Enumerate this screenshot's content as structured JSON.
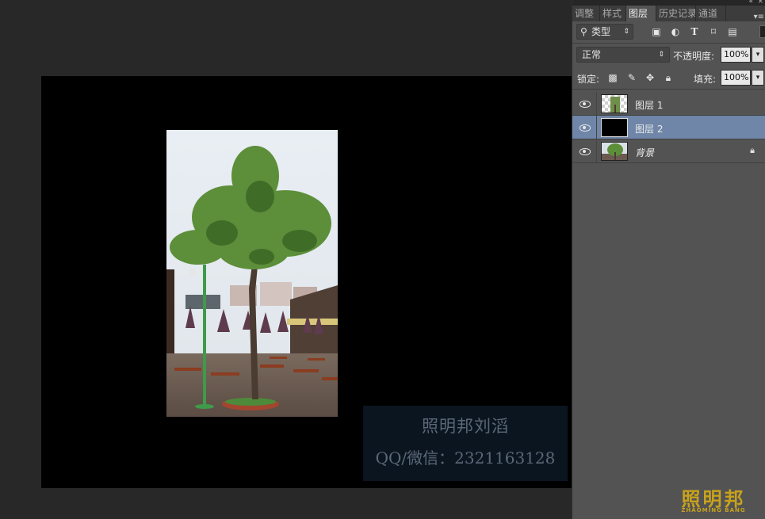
{
  "panel": {
    "tabs": [
      "调整",
      "样式",
      "图层",
      "历史记录",
      "通道"
    ],
    "filter": {
      "selected": "类型"
    },
    "blend_mode": "正常",
    "opacity_label": "不透明度:",
    "opacity_value": "100%",
    "lock_label": "锁定:",
    "fill_label": "填充:",
    "fill_value": "100%",
    "layers": [
      {
        "name": "图层 1",
        "visible": true,
        "selected": false,
        "thumbnail": "tree-photo-transparent"
      },
      {
        "name": "图层 2",
        "visible": true,
        "selected": true,
        "thumbnail": "black-fill"
      },
      {
        "name": "背景",
        "visible": true,
        "selected": false,
        "locked": true,
        "thumbnail": "tree-photo"
      }
    ]
  },
  "canvas": {
    "watermark_line1": "照明邦刘滔",
    "watermark_line2": "QQ/微信：2321163128"
  },
  "brand": {
    "name_cn": "照明邦",
    "name_en": "ZHAOMING BANG",
    "color": "#c8a21d"
  },
  "colors": {
    "workspace": "#282828",
    "panel": "#535353",
    "selection": "#6f86a8"
  }
}
